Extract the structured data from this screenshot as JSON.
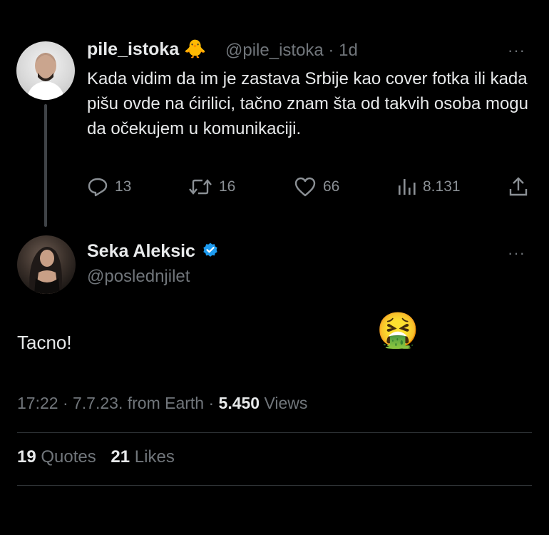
{
  "parent_tweet": {
    "display_name": "pile_istoka",
    "name_emoji": "🐥",
    "handle_time": "@pile_istoka · 1d",
    "text": "Kada vidim da im je zastava Srbije kao cover fotka ili kada pišu ovde na ćirilici, tačno znam šta od takvih osoba mogu da očekujem u komunikaciji.",
    "more": "···",
    "actions": {
      "replies": "13",
      "retweets": "16",
      "likes": "66",
      "views": "8.131"
    }
  },
  "reply_tweet": {
    "display_name": "Seka Aleksic",
    "handle": "@poslednjilet",
    "more": "···",
    "text": "Tacno!",
    "emoji": "🤮",
    "meta_prefix": "17:22 · 7.7.23. from Earth · ",
    "views_count": "5.450",
    "views_label": " Views",
    "quotes_count": "19",
    "quotes_label": " Quotes",
    "likes_count": "21",
    "likes_label": " Likes"
  },
  "colors": {
    "background": "#000000",
    "text": "#e7e9ea",
    "muted": "#71767b",
    "verified": "#1d9bf0",
    "divider": "#2f3336"
  }
}
